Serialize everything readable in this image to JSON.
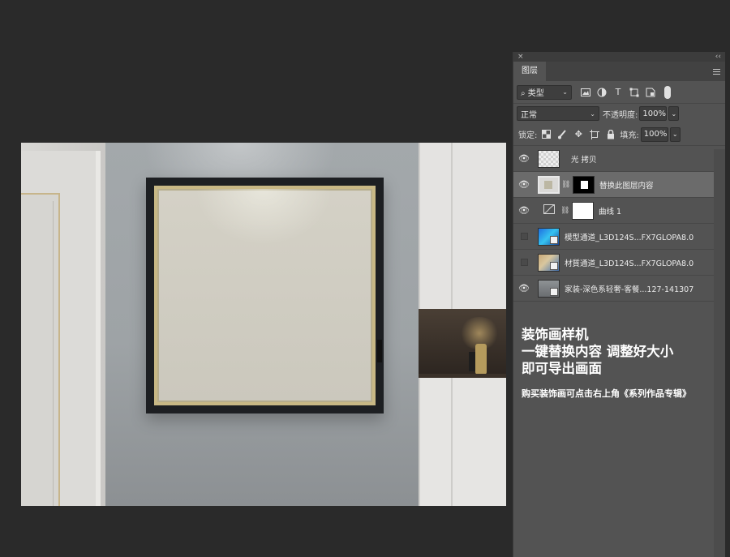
{
  "panel": {
    "close_glyph": "×",
    "collapse_glyph": "‹‹",
    "tab_label": "图层"
  },
  "filter": {
    "kind_label": "类型",
    "icons": [
      "image-filter-icon",
      "adjustment-filter-icon",
      "type-filter-icon",
      "shape-filter-icon",
      "smart-object-filter-icon"
    ]
  },
  "blend": {
    "mode": "正常",
    "opacity_label": "不透明度:",
    "opacity_value": "100%"
  },
  "lock": {
    "label": "锁定:",
    "fill_label": "填充:",
    "fill_value": "100%"
  },
  "layers": [
    {
      "name": "光 拷贝",
      "visible": true,
      "selected": false
    },
    {
      "name": "替换此图层内容",
      "visible": true,
      "selected": true
    },
    {
      "name": "曲线 1",
      "visible": true,
      "selected": false
    },
    {
      "name": "模型通道_L3D124S...FX7GLOPA8.0",
      "visible": false,
      "selected": false
    },
    {
      "name": "材質通道_L3D124S...FX7GLOPA8.0",
      "visible": false,
      "selected": false
    },
    {
      "name": "家装-深色系轻奢-客餐...127-141307",
      "visible": true,
      "selected": false
    }
  ],
  "promo": {
    "line1": "装饰画样机",
    "line2": "一键替换内容 调整好大小",
    "line3": "即可导出画面",
    "note": "购买装饰画可点击右上角《系列作品专辑》"
  },
  "colors": {
    "background": "#2a2a2a",
    "panel": "#535353",
    "selected_layer": "#6b6b6b"
  }
}
